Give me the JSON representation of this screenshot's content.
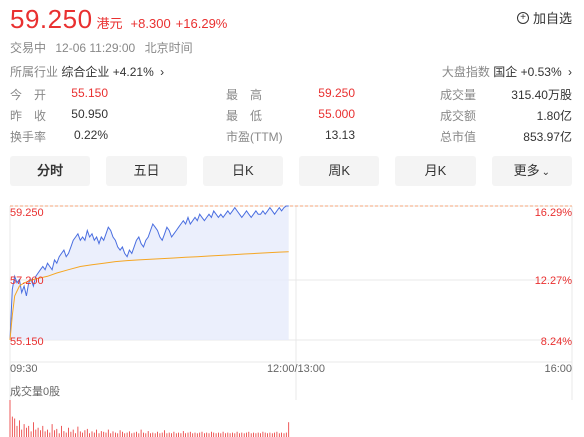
{
  "header": {
    "price": "59.250",
    "currency": "港元",
    "change": "+8.300",
    "change_pct": "+16.29%",
    "add_watch": "加自选",
    "up_color": "#e93030"
  },
  "status": {
    "state": "交易中",
    "time": "12-06 11:29:00",
    "zone": "北京时间"
  },
  "industry": {
    "label": "所属行业",
    "name": "综合企业",
    "pct": "+4.21%"
  },
  "market": {
    "label": "大盘指数",
    "name": "国企",
    "pct": "+0.53%"
  },
  "stats": {
    "rows": [
      [
        {
          "label": "今　开",
          "value": "55.150",
          "red": true
        },
        {
          "label": "最　高",
          "value": "59.250",
          "red": true
        },
        {
          "label": "成交量",
          "value": "315.40万股",
          "red": false
        }
      ],
      [
        {
          "label": "昨　收",
          "value": "50.950",
          "red": false
        },
        {
          "label": "最　低",
          "value": "55.000",
          "red": true
        },
        {
          "label": "成交额",
          "value": "1.80亿",
          "red": false
        }
      ],
      [
        {
          "label": "换手率",
          "value": "0.22%",
          "red": false
        },
        {
          "label": "市盈(TTM)",
          "value": "13.13",
          "red": false
        },
        {
          "label": "总市值",
          "value": "853.97亿",
          "red": false
        }
      ]
    ]
  },
  "tabs": [
    "分时",
    "五日",
    "日K",
    "周K",
    "月K",
    "更多"
  ],
  "chart_data": {
    "type": "line",
    "y_left_ticks": [
      "59.250",
      "57.200",
      "55.150"
    ],
    "y_right_ticks": [
      "16.29%",
      "12.27%",
      "8.24%"
    ],
    "x_ticks": [
      "09:30",
      "12:00/13:00",
      "16:00"
    ],
    "ylim": [
      55.15,
      59.25
    ],
    "volume_label": "成交量0股",
    "series": [
      {
        "color": "#4a6ee0",
        "x": [
          0,
          1,
          2,
          3,
          4,
          5,
          6,
          7,
          8,
          9,
          10,
          11,
          12,
          13,
          14,
          15,
          16,
          17,
          18,
          19,
          20,
          21,
          22,
          23,
          24,
          25,
          26,
          27,
          28,
          29,
          30,
          31,
          32,
          33,
          34,
          35,
          36,
          37,
          38,
          39,
          40,
          41,
          42,
          43,
          44,
          45,
          46,
          47,
          48,
          49,
          50,
          51,
          52,
          53,
          54,
          55,
          56,
          57,
          58,
          59,
          60,
          61,
          62,
          63,
          64,
          65,
          66,
          67,
          68,
          69,
          70,
          71,
          72,
          73,
          74,
          75,
          76,
          77,
          78,
          79,
          80,
          81,
          82,
          83,
          84,
          85,
          86,
          87,
          88,
          89,
          90,
          91,
          92,
          93,
          94,
          95,
          96,
          97,
          98,
          99,
          100,
          101,
          102,
          103,
          104,
          105,
          106,
          107,
          108,
          109,
          110,
          111,
          112,
          113,
          114,
          115,
          116,
          117,
          118,
          119
        ],
        "values": [
          55.15,
          56.7,
          57.1,
          56.9,
          57.0,
          56.6,
          56.8,
          56.5,
          56.9,
          57.0,
          56.8,
          57.1,
          57.2,
          57.3,
          57.4,
          57.3,
          57.5,
          57.4,
          57.3,
          57.6,
          57.5,
          57.7,
          57.8,
          57.9,
          57.7,
          57.8,
          58.0,
          58.2,
          58.3,
          58.4,
          58.2,
          58.3,
          58.2,
          58.5,
          58.3,
          58.4,
          58.2,
          58.3,
          58.1,
          58.3,
          58.2,
          58.4,
          58.6,
          58.5,
          58.3,
          58.2,
          58.0,
          57.9,
          58.0,
          57.8,
          57.7,
          57.9,
          57.8,
          58.0,
          58.2,
          58.3,
          58.1,
          58.0,
          58.2,
          58.3,
          58.5,
          58.7,
          58.6,
          58.5,
          58.3,
          58.2,
          58.4,
          58.6,
          58.5,
          58.3,
          58.4,
          58.5,
          58.6,
          58.7,
          58.8,
          58.7,
          58.9,
          58.7,
          58.8,
          58.9,
          58.8,
          59.0,
          58.9,
          58.8,
          58.9,
          59.0,
          58.9,
          59.1,
          59.0,
          58.9,
          59.0,
          58.9,
          59.0,
          59.1,
          59.0,
          59.1,
          59.2,
          59.1,
          59.0,
          58.9,
          59.0,
          59.1,
          59.0,
          58.9,
          59.0,
          59.1,
          59.0,
          59.0,
          59.1,
          59.0,
          59.1,
          59.2,
          59.1,
          59.0,
          59.1,
          59.2,
          59.1,
          59.2,
          59.25,
          59.25
        ]
      },
      {
        "color": "#f5a623",
        "x": [
          0,
          1,
          2,
          4,
          6,
          8,
          10,
          13,
          16,
          20,
          25,
          30,
          35,
          40,
          45,
          50,
          55,
          60,
          65,
          70,
          75,
          80,
          85,
          90,
          95,
          100,
          105,
          110,
          115,
          119
        ],
        "values": [
          55.15,
          55.9,
          56.5,
          56.8,
          56.9,
          56.95,
          57.0,
          57.05,
          57.1,
          57.2,
          57.3,
          57.4,
          57.45,
          57.5,
          57.55,
          57.58,
          57.6,
          57.62,
          57.64,
          57.66,
          57.68,
          57.7,
          57.72,
          57.74,
          57.76,
          57.78,
          57.8,
          57.82,
          57.84,
          57.85
        ]
      }
    ],
    "volume": [
      1.0,
      0.55,
      0.5,
      0.3,
      0.45,
      0.2,
      0.35,
      0.25,
      0.3,
      0.15,
      0.4,
      0.2,
      0.25,
      0.18,
      0.3,
      0.15,
      0.2,
      0.12,
      0.35,
      0.18,
      0.22,
      0.1,
      0.3,
      0.16,
      0.12,
      0.25,
      0.14,
      0.2,
      0.1,
      0.28,
      0.15,
      0.12,
      0.18,
      0.22,
      0.1,
      0.15,
      0.12,
      0.2,
      0.1,
      0.16,
      0.14,
      0.12,
      0.2,
      0.1,
      0.15,
      0.12,
      0.1,
      0.18,
      0.14,
      0.1,
      0.12,
      0.15,
      0.1,
      0.12,
      0.14,
      0.1,
      0.2,
      0.12,
      0.1,
      0.16,
      0.1,
      0.12,
      0.1,
      0.14,
      0.1,
      0.12,
      0.18,
      0.1,
      0.12,
      0.1,
      0.14,
      0.1,
      0.12,
      0.1,
      0.16,
      0.1,
      0.12,
      0.14,
      0.1,
      0.12,
      0.1,
      0.12,
      0.14,
      0.1,
      0.12,
      0.1,
      0.14,
      0.12,
      0.1,
      0.12,
      0.1,
      0.14,
      0.1,
      0.12,
      0.1,
      0.12,
      0.1,
      0.14,
      0.1,
      0.12,
      0.1,
      0.12,
      0.14,
      0.1,
      0.12,
      0.1,
      0.12,
      0.1,
      0.14,
      0.12,
      0.1,
      0.12,
      0.1,
      0.12,
      0.14,
      0.1,
      0.12,
      0.1,
      0.12,
      0.4
    ]
  },
  "colors": {
    "up": "#e93030",
    "grid": "#e8e8e8",
    "prevclose": "#f5a57a",
    "price_line": "#4a6ee0",
    "avg_line": "#f5a623"
  }
}
